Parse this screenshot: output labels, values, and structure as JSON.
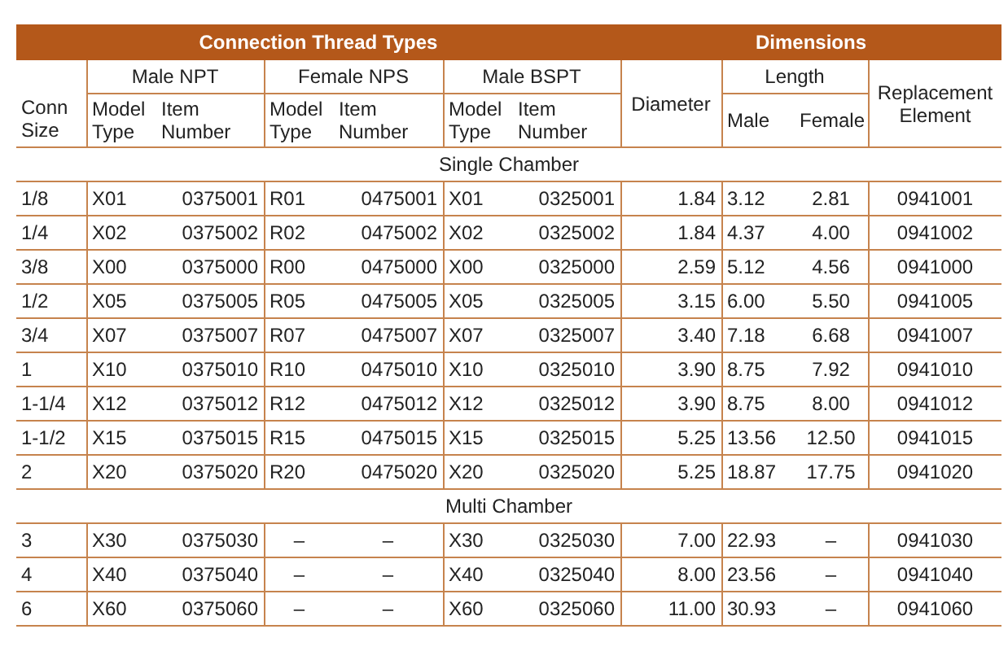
{
  "table": {
    "group_headers": [
      "Connection Thread Types",
      "Dimensions"
    ],
    "column_groups": [
      "Male NPT",
      "Female NPS",
      "Male BSPT"
    ],
    "columns": {
      "conn_size": "Conn Size",
      "model_type": [
        "Model Type",
        "Model Type",
        "Model Type"
      ],
      "item_number": [
        "Item Number",
        "Item Number",
        "Item Number"
      ],
      "diameter": "Diameter",
      "length": "Length",
      "length_male": "Male",
      "length_female": "Female",
      "replacement": "Replacement Element"
    },
    "sections": [
      {
        "label": "Single Chamber",
        "rows": [
          [
            "1/8",
            "X01",
            "0375001",
            "R01",
            "0475001",
            "X01",
            "0325001",
            "1.84",
            "3.12",
            "2.81",
            "0941001"
          ],
          [
            "1/4",
            "X02",
            "0375002",
            "R02",
            "0475002",
            "X02",
            "0325002",
            "1.84",
            "4.37",
            "4.00",
            "0941002"
          ],
          [
            "3/8",
            "X00",
            "0375000",
            "R00",
            "0475000",
            "X00",
            "0325000",
            "2.59",
            "5.12",
            "4.56",
            "0941000"
          ],
          [
            "1/2",
            "X05",
            "0375005",
            "R05",
            "0475005",
            "X05",
            "0325005",
            "3.15",
            "6.00",
            "5.50",
            "0941005"
          ],
          [
            "3/4",
            "X07",
            "0375007",
            "R07",
            "0475007",
            "X07",
            "0325007",
            "3.40",
            "7.18",
            "6.68",
            "0941007"
          ],
          [
            "1",
            "X10",
            "0375010",
            "R10",
            "0475010",
            "X10",
            "0325010",
            "3.90",
            "8.75",
            "7.92",
            "0941010"
          ],
          [
            "1-1/4",
            "X12",
            "0375012",
            "R12",
            "0475012",
            "X12",
            "0325012",
            "3.90",
            "8.75",
            "8.00",
            "0941012"
          ],
          [
            "1-1/2",
            "X15",
            "0375015",
            "R15",
            "0475015",
            "X15",
            "0325015",
            "5.25",
            "13.56",
            "12.50",
            "0941015"
          ],
          [
            "2",
            "X20",
            "0375020",
            "R20",
            "0475020",
            "X20",
            "0325020",
            "5.25",
            "18.87",
            "17.75",
            "0941020"
          ]
        ]
      },
      {
        "label": "Multi Chamber",
        "rows": [
          [
            "3",
            "X30",
            "0375030",
            "–",
            "–",
            "X30",
            "0325030",
            "7.00",
            "22.93",
            "–",
            "0941030"
          ],
          [
            "4",
            "X40",
            "0375040",
            "–",
            "–",
            "X40",
            "0325040",
            "8.00",
            "23.56",
            "–",
            "0941040"
          ],
          [
            "6",
            "X60",
            "0375060",
            "–",
            "–",
            "X60",
            "0325060",
            "11.00",
            "30.93",
            "–",
            "0941060"
          ]
        ]
      }
    ]
  }
}
